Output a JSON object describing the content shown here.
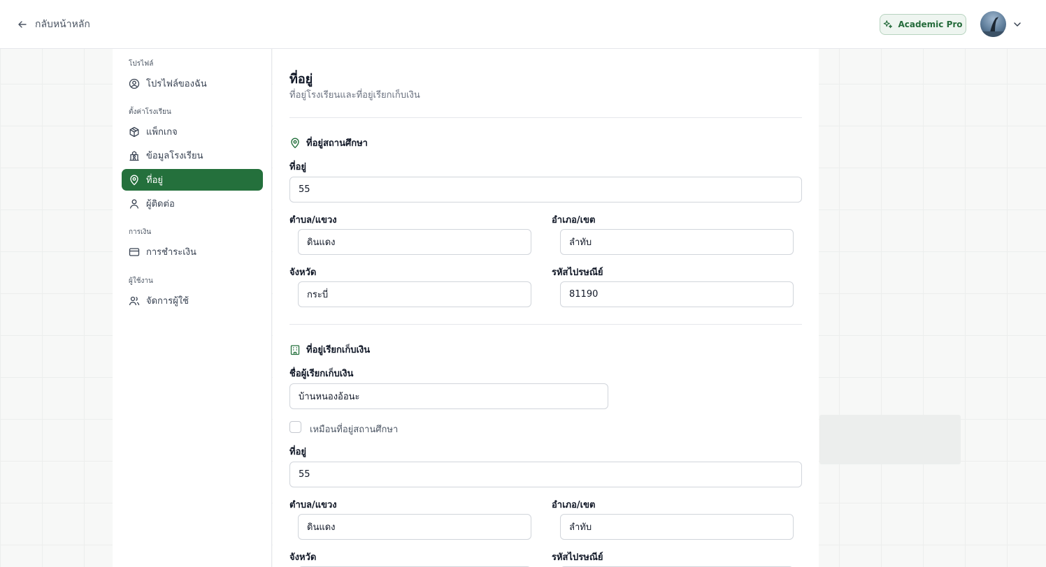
{
  "header": {
    "back_label": "กลับหน้าหลัก",
    "plan_badge": "Academic Pro"
  },
  "sidebar": {
    "sections": [
      {
        "title": "โปรไฟล์",
        "items": [
          {
            "label": "โปรไฟล์ของฉัน",
            "icon": "user-circle-icon"
          }
        ]
      },
      {
        "title": "ตั้งค่าโรงเรียน",
        "items": [
          {
            "label": "แพ็กเกจ",
            "icon": "package-icon"
          },
          {
            "label": "ข้อมูลโรงเรียน",
            "icon": "school-icon"
          },
          {
            "label": "ที่อยู่",
            "icon": "map-pin-icon",
            "active": true
          },
          {
            "label": "ผู้ติดต่อ",
            "icon": "user-icon"
          }
        ]
      },
      {
        "title": "การเงิน",
        "items": [
          {
            "label": "การชำระเงิน",
            "icon": "credit-card-icon"
          }
        ]
      },
      {
        "title": "ผู้ใช้งาน",
        "items": [
          {
            "label": "จัดการผู้ใช้",
            "icon": "users-icon"
          }
        ]
      }
    ]
  },
  "page": {
    "title": "ที่อยู่",
    "subtitle": "ที่อยู่โรงเรียนและที่อยู่เรียกเก็บเงิน"
  },
  "school_address": {
    "heading": "ที่อยู่สถานศึกษา",
    "address_label": "ที่อยู่",
    "address_value": "55",
    "subdistrict_label": "ตำบล/แขวง",
    "subdistrict_value": "ดินแดง",
    "district_label": "อำเภอ/เขต",
    "district_value": "ลำทับ",
    "province_label": "จังหวัด",
    "province_value": "กระบี่",
    "postal_label": "รหัสไปรษณีย์",
    "postal_value": "81190"
  },
  "billing_address": {
    "heading": "ที่อยู่เรียกเก็บเงิน",
    "billing_name_label": "ชื่อผู้เรียกเก็บเงิน",
    "billing_name_value": "บ้านหนองอ้อนะ",
    "same_as_label": "เหมือนที่อยู่สถานศึกษา",
    "same_as_checked": false,
    "address_label": "ที่อยู่",
    "address_value": "55",
    "subdistrict_label": "ตำบล/แขวง",
    "subdistrict_value": "ดินแดง",
    "district_label": "อำเภอ/เขต",
    "district_value": "ลำทับ",
    "province_label": "จังหวัด",
    "postal_label": "รหัสไปรษณีย์"
  },
  "colors": {
    "accent": "#24703c",
    "badge_bg": "#eef5f0",
    "badge_text": "#256b3b"
  }
}
